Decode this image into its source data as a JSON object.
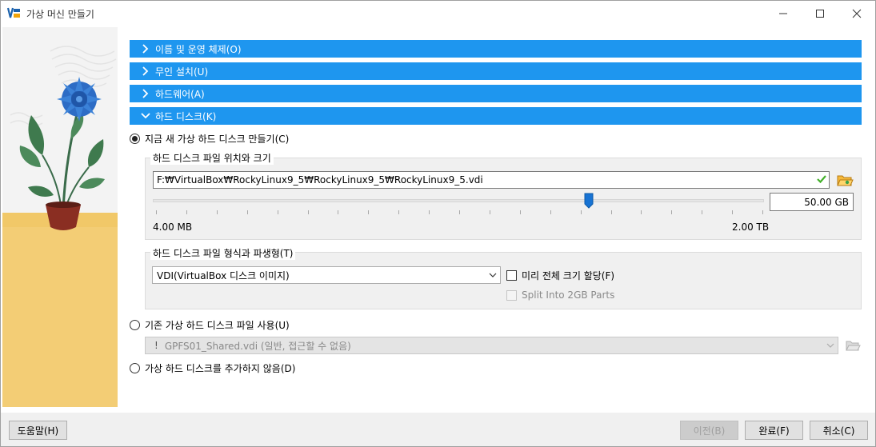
{
  "window": {
    "title": "가상 머신 만들기"
  },
  "sections": [
    {
      "label": "이름 및 운영 체제(O)",
      "expanded": false
    },
    {
      "label": "무인 설치(U)",
      "expanded": false
    },
    {
      "label": "하드웨어(A)",
      "expanded": false
    },
    {
      "label": "하드 디스크(K)",
      "expanded": true
    }
  ],
  "hard_disk": {
    "option_create": "지금 새 가상 하드 디스크 만들기(C)",
    "location_group_title": "하드 디스크 파일 위치와 크기",
    "file_path": "F:₩VirtualBox₩RockyLinux9_5₩RockyLinux9_5₩RockyLinux9_5.vdi",
    "size_value": "50.00 GB",
    "size_min_label": "4.00 MB",
    "size_max_label": "2.00 TB",
    "slider_position_fraction": 0.714,
    "format_group_title": "하드 디스크 파일 형식과 파생형(T)",
    "format_selected": "VDI(VirtualBox 디스크 이미지)",
    "preallocate_label": "미리 전체 크기 할당(F)",
    "split_label": "Split Into 2GB Parts",
    "option_existing": "기존 가상 하드 디스크 파일 사용(U)",
    "existing_file": "GPFS01_Shared.vdi (일반, 접근할 수 없음)",
    "existing_prefix": "!",
    "option_none": "가상 하드 디스크를 추가하지 않음(D)"
  },
  "buttons": {
    "help": "도움말(H)",
    "back": "이전(B)",
    "finish": "완료(F)",
    "cancel": "취소(C)"
  },
  "colors": {
    "section_header": "#1e96ef",
    "accent_check": "#43b02a"
  },
  "icons": {
    "app": "virtualbox-icon",
    "minimize": "minimize-icon",
    "maximize": "maximize-icon",
    "close": "close-icon",
    "folder": "folder-open-icon"
  }
}
